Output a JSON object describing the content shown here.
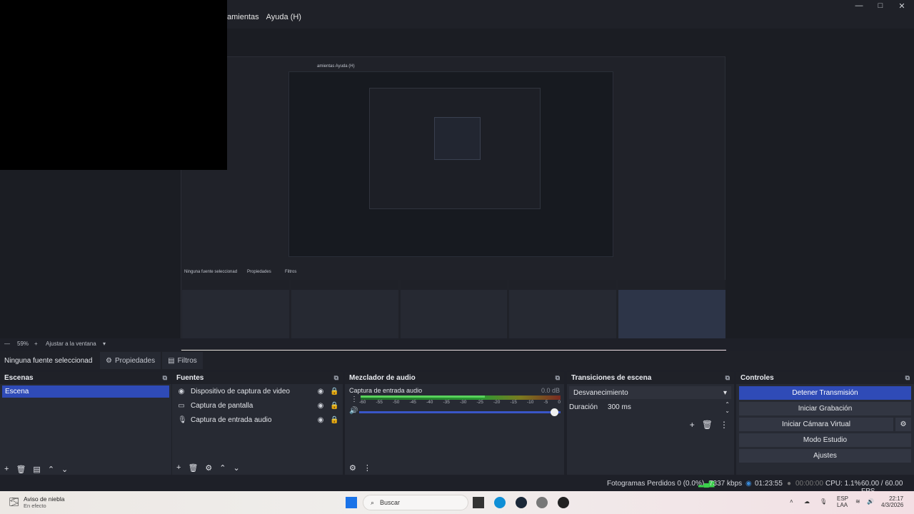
{
  "menu": {
    "items": [
      "amientas",
      "Ayuda (H)"
    ]
  },
  "window_controls": [
    "—",
    "□",
    "✕"
  ],
  "preview": {
    "zoom": "59%",
    "fit_label": "Ajustar a la ventana",
    "nested_menu": "amientas   Ayuda (H)",
    "nested_sourcebar": "Ninguna fuente seleccionad",
    "nested_props": "Propiedades",
    "nested_filters": "Filtros"
  },
  "source_bar": {
    "no_source": "Ninguna fuente seleccionad",
    "properties": "Propiedades",
    "filters": "Filtros"
  },
  "scenes": {
    "title": "Escenas",
    "items": [
      "Escena"
    ]
  },
  "sources": {
    "title": "Fuentes",
    "items": [
      "Dispositivo de captura de video",
      "Captura de pantalla",
      "Captura de entrada audio"
    ]
  },
  "mixer": {
    "title": "Mezclador de audio",
    "channel": "Captura de entrada audio",
    "db": "0.0 dB",
    "level": 0.62,
    "ticks": [
      "-60",
      "-55",
      "-50",
      "-45",
      "-40",
      "-35",
      "-30",
      "-25",
      "-20",
      "-15",
      "-10",
      "-5",
      "0"
    ]
  },
  "transitions": {
    "title": "Transiciones de escena",
    "selected": "Desvanecimiento",
    "duration_label": "Duración",
    "duration_value": "300 ms"
  },
  "controls": {
    "title": "Controles",
    "stop_stream": "Detener Transmisión",
    "start_record": "Iniciar Grabación",
    "start_vcam": "Iniciar Cámara Virtual",
    "studio_mode": "Modo Estudio",
    "settings": "Ajustes"
  },
  "status": {
    "dropped": "Fotogramas Perdidos 0 (0.0%)",
    "bitrate": "7337 kbps",
    "stream_time": "01:23:55",
    "rec_time": "00:00:00",
    "cpu": "CPU: 1.1%",
    "fps": "60.00 / 60.00 FPS"
  },
  "taskbar": {
    "weather_title": "Aviso de niebla",
    "weather_sub": "En efecto",
    "search": "Buscar",
    "lang1": "ESP",
    "lang2": "LAA",
    "time": "22:17",
    "date": "4/3/2026"
  },
  "colors": {
    "accent": "#2f4bb7",
    "panel": "#272a33",
    "header": "#1f2128"
  }
}
